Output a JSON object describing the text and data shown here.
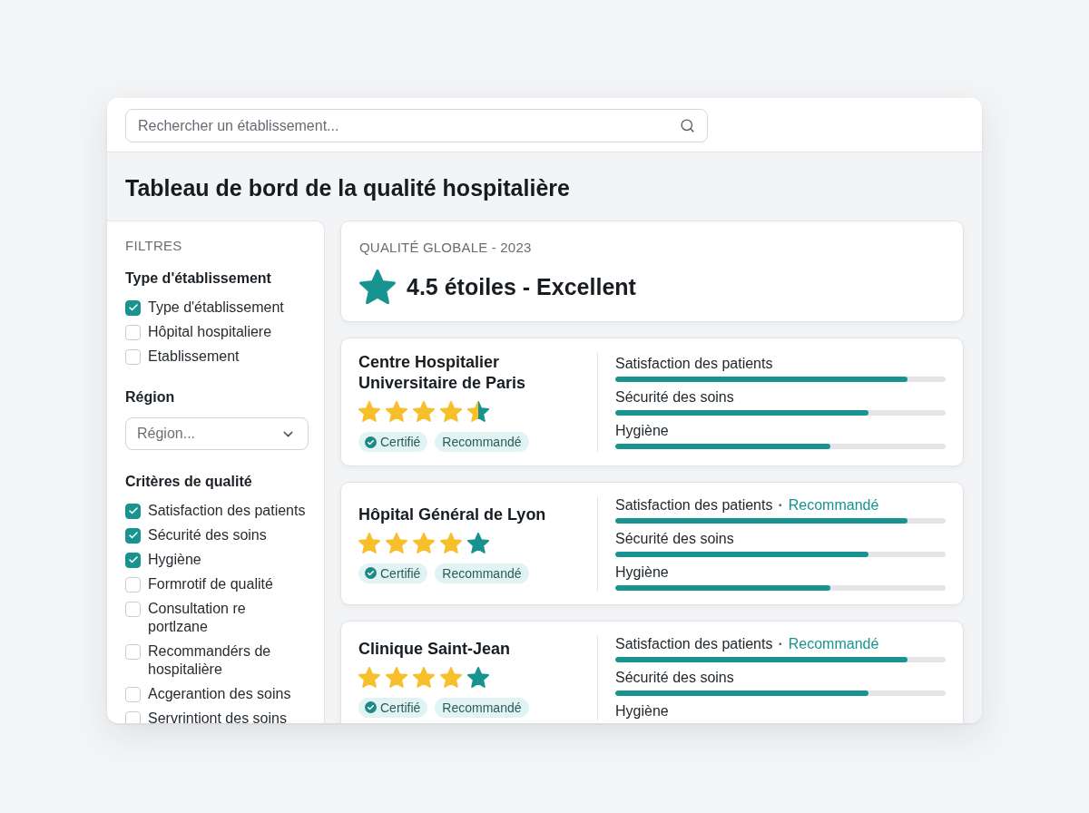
{
  "search": {
    "placeholder": "Rechercher un établissement..."
  },
  "title": "Tableau de bord de la qualité hospitalière",
  "filters": {
    "heading": "FILTRES",
    "groups": [
      {
        "kind": "checklist",
        "title": "Type d'établissement",
        "options": [
          {
            "label": "Type d'établissement",
            "checked": true
          },
          {
            "label": "Hôpital hospitaliere",
            "checked": false
          },
          {
            "label": "Etablissement",
            "checked": false
          }
        ]
      },
      {
        "kind": "select",
        "title": "Région",
        "placeholder": "Région..."
      },
      {
        "kind": "checklist",
        "title": "Critères de qualité",
        "options": [
          {
            "label": "Satisfaction des patients",
            "checked": true
          },
          {
            "label": "Sécurité des soins",
            "checked": true
          },
          {
            "label": "Hygiène",
            "checked": true
          },
          {
            "label": "Formrotif de qualité",
            "checked": false
          },
          {
            "label": "Consultation re portlzane",
            "checked": false
          },
          {
            "label": "Recommandérs de hospitalière",
            "checked": false
          },
          {
            "label": "Acgerantion des soins",
            "checked": false
          },
          {
            "label": "Servrintiont des soins",
            "checked": false
          }
        ]
      }
    ]
  },
  "overall": {
    "label": "QUALITÉ GLOBALE - 2023",
    "rating": "4.5 étoiles - Excellent"
  },
  "hospitals": [
    {
      "name": "Centre Hospitalier Universitaire de Paris",
      "stars": 4.5,
      "badges": [
        {
          "kind": "certified",
          "label": "Certifié"
        },
        {
          "kind": "plain",
          "label": "Recommandé"
        }
      ],
      "metrics": [
        {
          "label": "Satisfaction des patients",
          "level": 0.885
        },
        {
          "label": "Sécurité des soins",
          "level": 0.767
        },
        {
          "label": "Hygiène",
          "level": 0.652
        }
      ]
    },
    {
      "name": "Hôpital Général de Lyon",
      "stars": 4,
      "badges": [
        {
          "kind": "certified",
          "label": "Certifié"
        },
        {
          "kind": "plain",
          "label": "Recommandé"
        }
      ],
      "metrics": [
        {
          "label": "Satisfaction des patients",
          "separator": "·",
          "note": "Recommandé",
          "level": 0.885
        },
        {
          "label": "Sécurité des soins",
          "level": 0.767
        },
        {
          "label": "Hygiène",
          "level": 0.652
        }
      ]
    },
    {
      "name": "Clinique Saint-Jean",
      "stars": 4,
      "badges": [
        {
          "kind": "certified",
          "label": "Certifié"
        },
        {
          "kind": "plain",
          "label": "Recommandé"
        }
      ],
      "metrics": [
        {
          "label": "Satisfaction des patients",
          "separator": "·",
          "note": "Recommandé",
          "level": 0.885
        },
        {
          "label": "Sécurité des soins",
          "level": 0.767
        },
        {
          "label": "Hygiène"
        }
      ]
    }
  ]
}
